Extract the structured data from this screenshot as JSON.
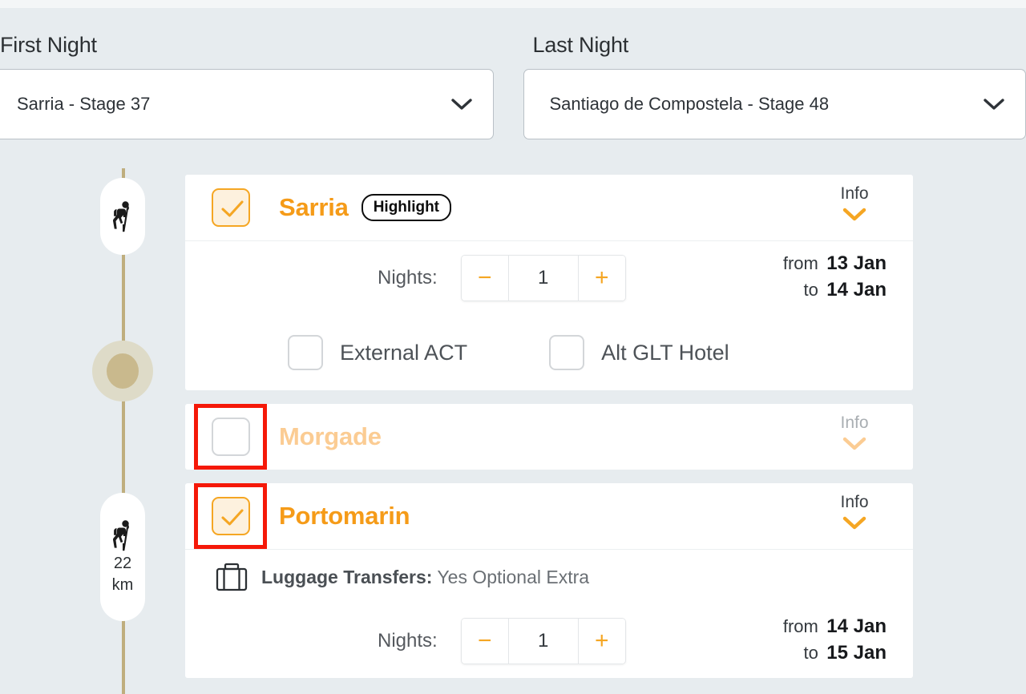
{
  "selectors": [
    {
      "label": "First Night",
      "value": "Sarria - Stage 37",
      "icon": "chevron-down-icon"
    },
    {
      "label": "Last Night",
      "value": "Santiago de Compostela - Stage 48",
      "icon": "chevron-down-icon"
    }
  ],
  "timeline": {
    "markers": [
      {
        "icon": "hiker-icon",
        "distance": null,
        "unit": null
      },
      {
        "icon": "hiker-icon",
        "distance": "22",
        "unit": "km"
      }
    ],
    "line_color": "#bfae7e",
    "dot_outer_color": "#dedbc8",
    "dot_inner_color": "#c9b98d"
  },
  "colors": {
    "accent": "#f59b18",
    "accent_muted": "#fbcc93",
    "highlight_box": "#f51808",
    "checkbox_fill": "#fdf1de",
    "page_background": "#e7ecef"
  },
  "cards": [
    {
      "name": "Sarria",
      "checked": true,
      "muted": false,
      "flagged": false,
      "badge": "Highlight",
      "info_label": "Info",
      "info_icon": "chevron-down-icon",
      "info_muted": false,
      "nights": {
        "label": "Nights:",
        "minus": "−",
        "plus": "+",
        "value": "1"
      },
      "dates": {
        "from_label": "from",
        "from_value": "13 Jan",
        "to_label": "to",
        "to_value": "14 Jan"
      },
      "options": [
        {
          "label": "External ACT",
          "checked": false
        },
        {
          "label": "Alt GLT Hotel",
          "checked": false
        }
      ]
    },
    {
      "name": "Morgade",
      "checked": false,
      "muted": true,
      "flagged": true,
      "badge": null,
      "info_label": "Info",
      "info_icon": "chevron-down-icon",
      "info_muted": true
    },
    {
      "name": "Portomarin",
      "checked": true,
      "muted": false,
      "flagged": true,
      "badge": null,
      "info_label": "Info",
      "info_icon": "chevron-down-icon",
      "info_muted": false,
      "luggage": {
        "icon": "suitcase-icon",
        "label": "Luggage Transfers:",
        "value": "Yes Optional Extra"
      },
      "nights": {
        "label": "Nights:",
        "minus": "−",
        "plus": "+",
        "value": "1"
      },
      "dates": {
        "from_label": "from",
        "from_value": "14 Jan",
        "to_label": "to",
        "to_value": "15 Jan"
      }
    }
  ]
}
